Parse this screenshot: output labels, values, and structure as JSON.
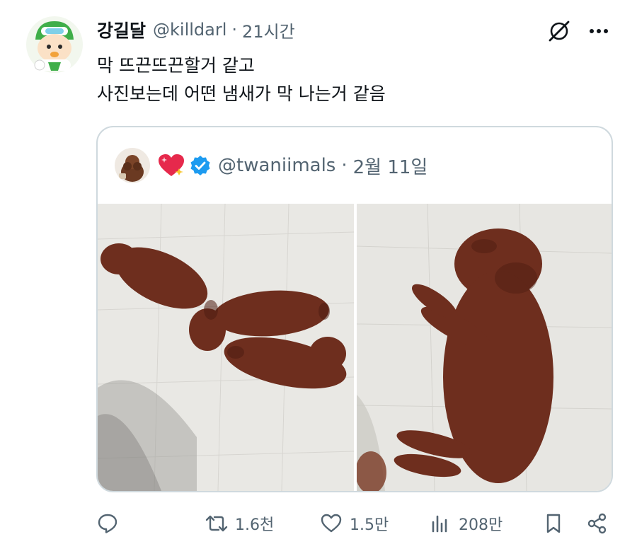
{
  "author": {
    "display_name": "강길달",
    "handle": "@killdarl",
    "separator": "·",
    "time": "21시간"
  },
  "tweet_text": {
    "line1": "막 뜨끈뜨끈할거 같고",
    "line2": "사진보는데 어떤 냄새가 막 나는거 같음"
  },
  "quote": {
    "handle": "@twaniimals",
    "separator": "·",
    "time": "2월 11일"
  },
  "metrics": {
    "replies": "",
    "retweets": "1.6천",
    "likes": "1.5만",
    "views": "208만"
  },
  "icons": {
    "reply": "reply-icon",
    "retweet": "retweet-icon",
    "like": "heart-icon",
    "views": "views-icon",
    "bookmark": "bookmark-icon",
    "share": "share-icon",
    "grok": "grok-icon",
    "more": "more-icon",
    "verified": "verified-badge-icon",
    "emoji": "sparkling-heart-icon"
  },
  "colors": {
    "secondary_text": "#536471",
    "border": "#cfd9de",
    "verified": "#1d9bf0",
    "puppy": "#6e2e1e"
  }
}
